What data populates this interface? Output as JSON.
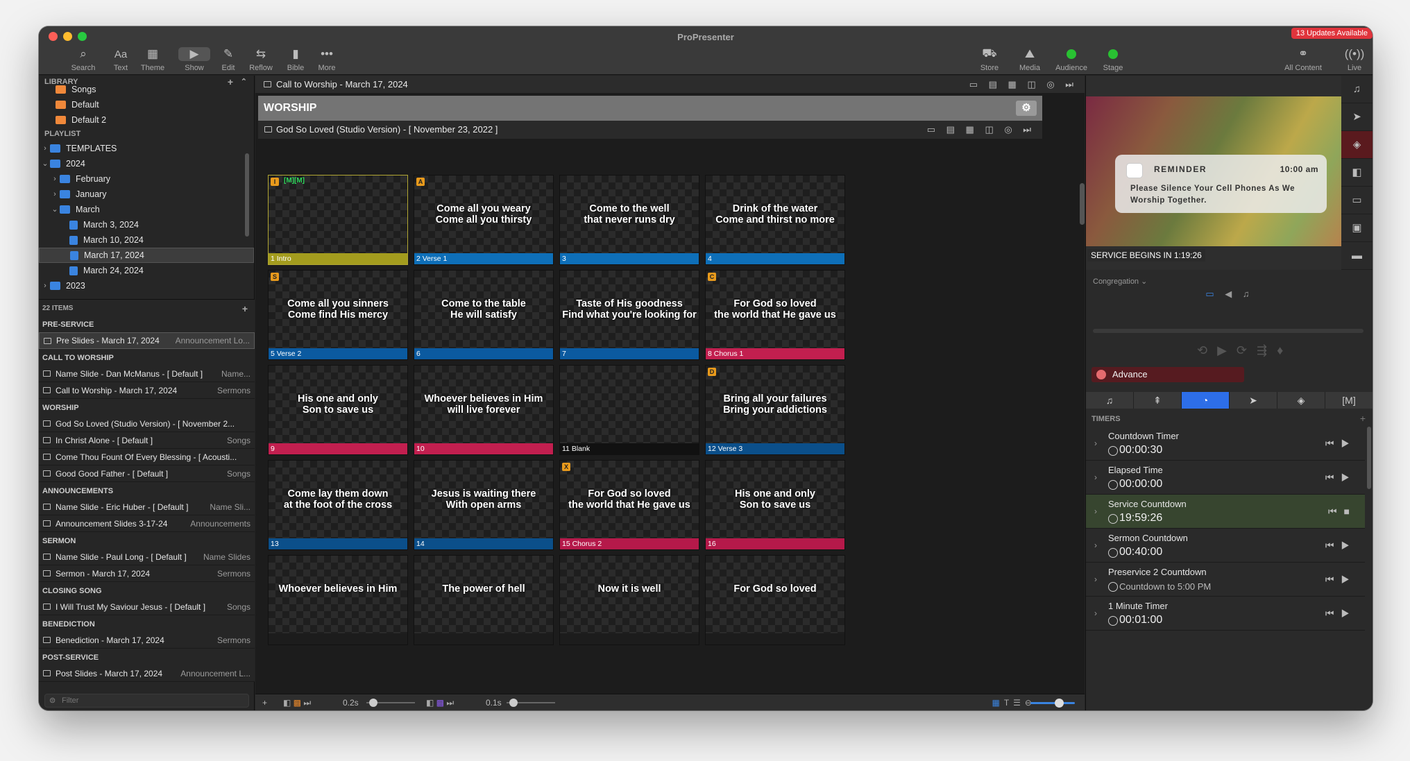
{
  "window": {
    "title": "ProPresenter",
    "updates_badge": "13 Updates Available"
  },
  "toolbar": [
    {
      "label": "Search",
      "icon": "search-icon"
    },
    {
      "label": "Text",
      "glyph": "Aa"
    },
    {
      "label": "Theme",
      "icon": "theme-icon"
    },
    {
      "label": "Show",
      "icon": "play-icon"
    },
    {
      "label": "Edit",
      "icon": "pencil-icon"
    },
    {
      "label": "Reflow",
      "icon": "reflow-icon"
    },
    {
      "label": "Bible",
      "icon": "bible-icon"
    },
    {
      "label": "More",
      "icon": "ellipsis-icon"
    },
    {
      "label": "Store",
      "icon": "cart-icon"
    },
    {
      "label": "Media",
      "icon": "media-icon"
    },
    {
      "label": "Audience",
      "icon": "status-dot",
      "color": "#29c132"
    },
    {
      "label": "Stage",
      "icon": "status-dot",
      "color": "#29c132"
    },
    {
      "label": "All Content",
      "icon": "all-content-icon"
    },
    {
      "label": "Live",
      "icon": "live-icon"
    }
  ],
  "library": {
    "header": "LIBRARY",
    "items": [
      {
        "label": "Songs",
        "color": "#f0883a"
      },
      {
        "label": "Default",
        "color": "#f0883a"
      },
      {
        "label": "Default 2",
        "color": "#f0883a"
      }
    ]
  },
  "playlist": {
    "header": "PLAYLIST",
    "tree": [
      {
        "label": "TEMPLATES",
        "level": 0,
        "chev": "›",
        "color": "#3a84e0"
      },
      {
        "label": "2024",
        "level": 0,
        "chev": "⌄",
        "color": "#3a84e0"
      },
      {
        "label": "February",
        "level": 1,
        "chev": "›",
        "color": "#3a84e0"
      },
      {
        "label": "January",
        "level": 1,
        "chev": "›",
        "color": "#3a84e0"
      },
      {
        "label": "March",
        "level": 1,
        "chev": "⌄",
        "color": "#3a84e0"
      },
      {
        "label": "March 3, 2024",
        "level": 2,
        "chev": "",
        "color": "#3a84e0"
      },
      {
        "label": "March 10, 2024",
        "level": 2,
        "chev": "",
        "color": "#3a84e0"
      },
      {
        "label": "March 17, 2024",
        "level": 2,
        "chev": "",
        "color": "#3a84e0",
        "selected": true
      },
      {
        "label": "March 24, 2024",
        "level": 2,
        "chev": "",
        "color": "#3a84e0"
      },
      {
        "label": "2023",
        "level": 0,
        "chev": "›",
        "color": "#3a84e0"
      }
    ]
  },
  "playlist_items": {
    "count_label": "22 ITEMS",
    "entries": [
      {
        "header": "PRE-SERVICE"
      },
      {
        "name": "Pre Slides - March 17, 2024",
        "type": "Announcement Lo...",
        "selected": true
      },
      {
        "header": "CALL TO WORSHIP"
      },
      {
        "name": "Name Slide - Dan McManus - [ Default ]",
        "type": "Name..."
      },
      {
        "name": "Call to Worship - March 17, 2024",
        "type": "Sermons"
      },
      {
        "header": "WORSHIP"
      },
      {
        "name": "God So Loved (Studio Version) - [ November 2...",
        "type": ""
      },
      {
        "name": "In Christ Alone - [ Default ]",
        "type": "Songs"
      },
      {
        "name": "Come Thou Fount Of Every Blessing - [ Acousti...",
        "type": ""
      },
      {
        "name": "Good Good Father - [ Default ]",
        "type": "Songs"
      },
      {
        "header": "ANNOUNCEMENTS"
      },
      {
        "name": "Name Slide - Eric Huber - [ Default ]",
        "type": "Name Sli..."
      },
      {
        "name": "Announcement Slides 3-17-24",
        "type": "Announcements"
      },
      {
        "header": "SERMON"
      },
      {
        "name": "Name Slide - Paul Long - [ Default ]",
        "type": "Name Slides"
      },
      {
        "name": "Sermon - March 17, 2024",
        "type": "Sermons"
      },
      {
        "header": "CLOSING SONG"
      },
      {
        "name": "I Will Trust My Saviour Jesus - [ Default ]",
        "type": "Songs"
      },
      {
        "header": "BENEDICTION"
      },
      {
        "name": "Benediction - March 17, 2024",
        "type": "Sermons"
      },
      {
        "header": "POST-SERVICE"
      },
      {
        "name": "Post Slides - March 17, 2024",
        "type": "Announcement L..."
      }
    ],
    "filter_placeholder": "Filter"
  },
  "center": {
    "top_item": "Call to Worship - March 17, 2024",
    "group": "WORSHIP",
    "presentation": "God So Loved (Studio Version) - [ November 23, 2022 ]",
    "slides": [
      {
        "label": "1 Intro",
        "color": "#a39c1e",
        "text": "",
        "hotkey": "I",
        "arr": "[M][M]"
      },
      {
        "label": "2 Verse 1",
        "color": "#0e6fb8",
        "text": "Come all you weary\nCome all you thirsty",
        "hotkey": "A"
      },
      {
        "label": "3",
        "color": "#0e6fb8",
        "text": "Come to the well\nthat never runs dry"
      },
      {
        "label": "4",
        "color": "#0e6fb8",
        "text": "Drink of the water\nCome and thirst no more"
      },
      {
        "label": "5 Verse 2",
        "color": "#0b5aa0",
        "text": "Come all you sinners\nCome find His mercy",
        "hotkey": "S"
      },
      {
        "label": "6",
        "color": "#0b5aa0",
        "text": "Come to the table\nHe will satisfy"
      },
      {
        "label": "7",
        "color": "#0b5aa0",
        "text": "Taste of His goodness\nFind what you're looking for"
      },
      {
        "label": "8 Chorus 1",
        "color": "#c21f4f",
        "text": "For God so loved\nthe world that He gave us",
        "hotkey": "C"
      },
      {
        "label": "9",
        "color": "#c21f4f",
        "text": "His one and only\nSon to save us"
      },
      {
        "label": "10",
        "color": "#c21f4f",
        "text": "Whoever believes in Him\nwill live forever"
      },
      {
        "label": "11 Blank",
        "color": "#111111",
        "text": ""
      },
      {
        "label": "12 Verse 3",
        "color": "#0b4f8a",
        "text": "Bring all your failures\nBring your addictions",
        "hotkey": "D"
      },
      {
        "label": "13",
        "color": "#0b4f8a",
        "text": "Come lay them down\nat the foot of the cross"
      },
      {
        "label": "14",
        "color": "#0b4f8a",
        "text": "Jesus is waiting there\nWith open arms"
      },
      {
        "label": "15 Chorus 2",
        "color": "#b5194a",
        "text": "For God so loved\nthe world that He gave us",
        "hotkey": "X"
      },
      {
        "label": "16",
        "color": "#b5194a",
        "text": "His one and only\nSon to save us"
      },
      {
        "label": "",
        "color": "#b5194a",
        "text": "Whoever believes in Him"
      },
      {
        "label": "",
        "color": "#b5194a",
        "text": "The power of hell"
      },
      {
        "label": "",
        "color": "#b5194a",
        "text": "Now it is well"
      },
      {
        "label": "",
        "color": "#b5194a",
        "text": "For God so loved"
      }
    ],
    "bottom": {
      "fade1": "0.2s",
      "fade2": "0.1s"
    }
  },
  "right": {
    "reminder": {
      "title": "REMINDER",
      "time": "10:00 am",
      "message": "Please Silence Your Cell Phones As We Worship Together."
    },
    "service_begins": "SERVICE BEGINS IN 1:19:26",
    "screen": "Congregation",
    "advance": "Advance",
    "timers_header": "TIMERS",
    "timers": [
      {
        "name": "Countdown Timer",
        "value": "00:00:30"
      },
      {
        "name": "Elapsed Time",
        "value": "00:00:00"
      },
      {
        "name": "Service Countdown",
        "value": "19:59:26",
        "active": true
      },
      {
        "name": "Sermon Countdown",
        "value": "00:40:00"
      },
      {
        "name": "Preservice 2 Countdown",
        "value": "Countdown to 5:00 PM",
        "small": true
      },
      {
        "name": "1 Minute Timer",
        "value": "00:01:00"
      }
    ]
  }
}
